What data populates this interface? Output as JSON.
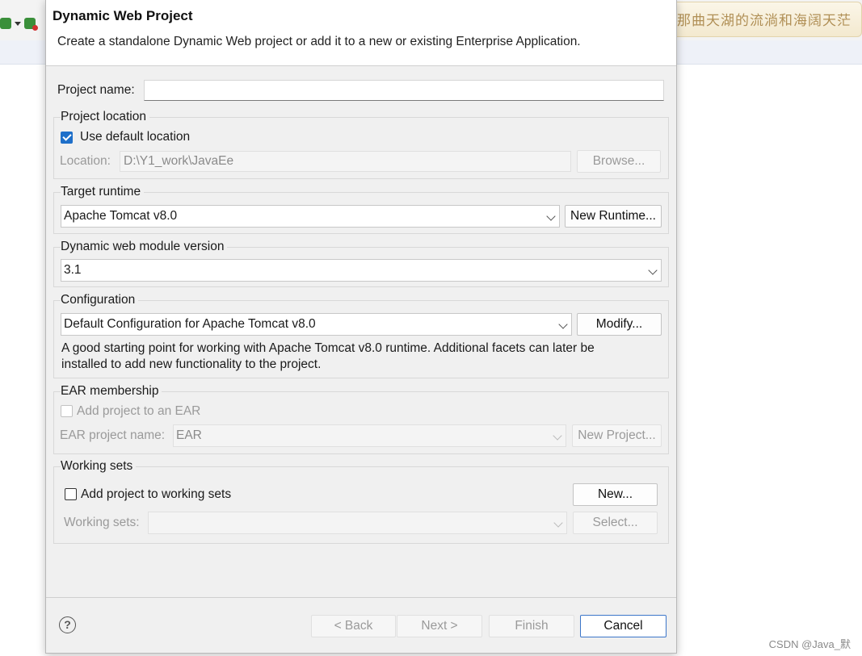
{
  "background": {
    "banner_text": "那曲天湖的流淌和海阔天茫",
    "watermark": "CSDN @Java_默"
  },
  "dialog": {
    "title": "Dynamic Web Project",
    "description": "Create a standalone Dynamic Web project or add it to a new or existing Enterprise Application.",
    "project_name": {
      "label": "Project name:",
      "value": ""
    },
    "project_location": {
      "group_label": "Project location",
      "use_default_label": "Use default location",
      "use_default_checked": true,
      "location_label": "Location:",
      "location_value": "D:\\Y1_work\\JavaEe",
      "browse_label": "Browse..."
    },
    "target_runtime": {
      "group_label": "Target runtime",
      "selected": "Apache Tomcat v8.0",
      "new_runtime_label": "New Runtime..."
    },
    "module_version": {
      "group_label": "Dynamic web module version",
      "selected": "3.1"
    },
    "configuration": {
      "group_label": "Configuration",
      "selected": "Default Configuration for Apache Tomcat v8.0",
      "modify_label": "Modify...",
      "description_line1": "A good starting point for working with Apache Tomcat v8.0 runtime. Additional facets can later be",
      "description_line2": "installed to add new functionality to the project."
    },
    "ear": {
      "group_label": "EAR membership",
      "add_label": "Add project to an EAR",
      "add_checked": false,
      "name_label": "EAR project name:",
      "name_value": "EAR",
      "new_project_label": "New Project..."
    },
    "working_sets": {
      "group_label": "Working sets",
      "add_label": "Add project to working sets",
      "add_checked": false,
      "new_label": "New...",
      "sets_label": "Working sets:",
      "sets_value": "",
      "select_label": "Select..."
    },
    "footer": {
      "help": "?",
      "back": "< Back",
      "next": "Next >",
      "finish": "Finish",
      "cancel": "Cancel"
    }
  }
}
